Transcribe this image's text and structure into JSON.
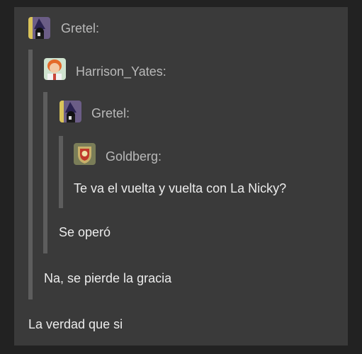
{
  "quotes": [
    {
      "author": "Gretel:",
      "avatar": "wizard-avatar-icon"
    },
    {
      "author": "Harrison_Yates:",
      "avatar": "red-haired-person-avatar-icon"
    },
    {
      "author": "Gretel:",
      "avatar": "wizard-avatar-icon"
    },
    {
      "author": "Goldberg:",
      "avatar": "crest-avatar-icon"
    }
  ],
  "messages": {
    "goldberg": "Te va el vuelta y vuelta con La Nicky?",
    "gretel_inner": "Se operó",
    "harrison": "Na, se pierde la gracia",
    "gretel_outer": "La verdad que si"
  },
  "colors": {
    "page_background": "#222222",
    "panel_background": "#3a3a3a",
    "quote_bar": "#5d5d5d",
    "author_text": "#b9b9b9",
    "message_text": "#ececec"
  }
}
